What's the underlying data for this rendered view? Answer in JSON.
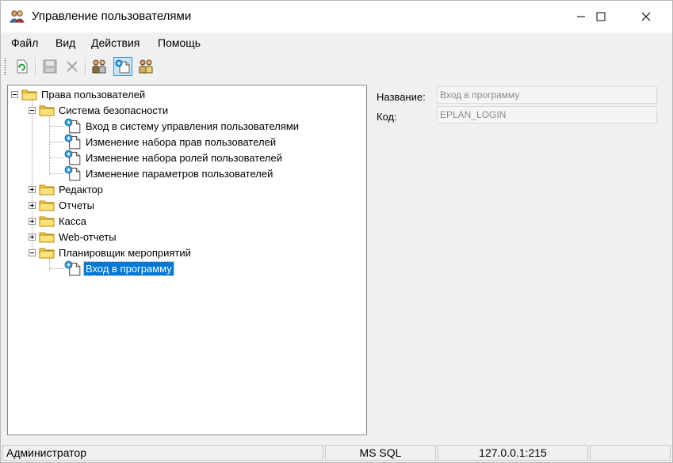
{
  "window": {
    "title": "Управление пользователями"
  },
  "menu": [
    "Файл",
    "Вид",
    "Действия",
    "Помощь"
  ],
  "toolbar": {
    "icons": [
      "refresh-icon",
      "save-icon",
      "delete-icon",
      "users-icon",
      "add-item-icon",
      "roles-icon"
    ]
  },
  "tree": {
    "root": "Права пользователей",
    "security": "Система безопасности",
    "security_items": [
      "Вход в систему управления пользователями",
      "Изменение набора прав пользователей",
      "Изменение набора ролей пользователей",
      "Изменение параметров пользователей"
    ],
    "editor": "Редактор",
    "reports": "Отчеты",
    "cash": "Касса",
    "web_reports": "Web-отчеты",
    "scheduler": "Планировщик мероприятий",
    "scheduler_item": "Вход в программу"
  },
  "properties": {
    "name_label": "Название:",
    "name_value": "Вход в программу",
    "code_label": "Код:",
    "code_value": "EPLAN_LOGIN"
  },
  "status": {
    "user": "Администратор",
    "db": "MS SQL",
    "server": "127.0.0.1:215"
  },
  "colors": {
    "selection": "#0078d7",
    "folder": "#f5c542"
  }
}
